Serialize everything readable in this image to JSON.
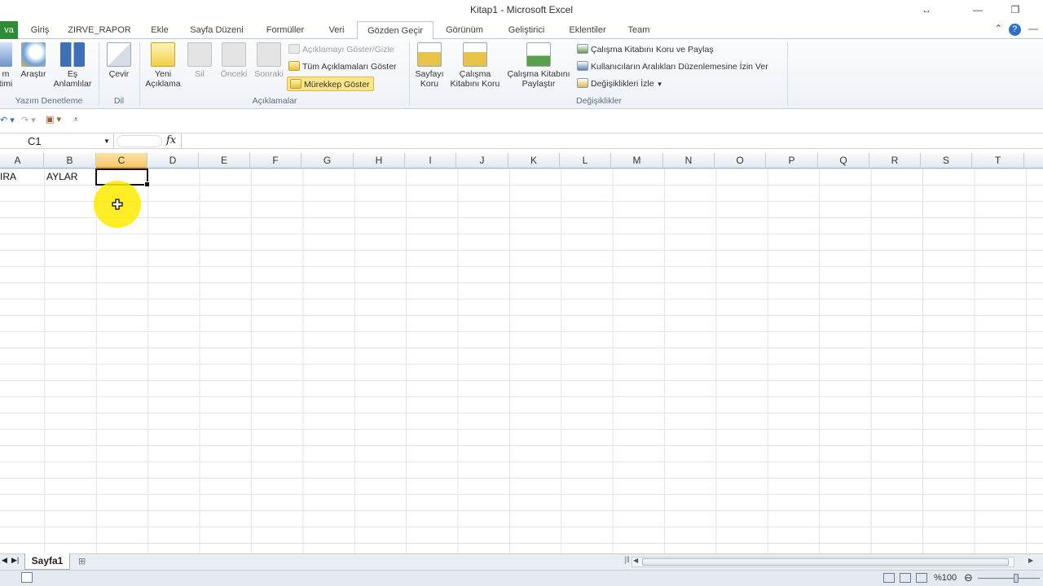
{
  "window": {
    "title": "Kitap1 - Microsoft Excel"
  },
  "tabs": {
    "file": "va",
    "items": [
      "Giriş",
      "ZIRVE_RAPOR",
      "Ekle",
      "Sayfa Düzeni",
      "Formüller",
      "Veri",
      "Gözden Geçir",
      "Görünüm",
      "Geliştirici",
      "Eklentiler",
      "Team"
    ],
    "active": "Gözden Geçir"
  },
  "ribbon": {
    "proofing": {
      "spell_label_line1": "m",
      "spell_label_line2": "timi",
      "research_label": "Araştır",
      "thesaurus_label_line1": "Eş",
      "thesaurus_label_line2": "Anlamlılar",
      "group_label": "Yazım Denetleme"
    },
    "language": {
      "translate_label": "Çevir",
      "group_label": "Dil"
    },
    "comments": {
      "new_comment_line1": "Yeni",
      "new_comment_line2": "Açıklama",
      "delete_label": "Sil",
      "previous_label": "Önceki",
      "next_label": "Sonraki",
      "show_hide_label": "Açıklamayı Göster/Gizle",
      "show_all_label": "Tüm Açıklamaları Göster",
      "show_ink_label": "Mürekkep Göster",
      "group_label": "Açıklamalar"
    },
    "changes": {
      "protect_sheet_line1": "Sayfayı",
      "protect_sheet_line2": "Koru",
      "protect_workbook_line1": "Çalışma",
      "protect_workbook_line2": "Kitabını Koru",
      "share_workbook_line1": "Çalışma Kitabını",
      "share_workbook_line2": "Paylaştır",
      "protect_share_label": "Çalışma Kitabını Koru ve Paylaş",
      "allow_edit_ranges_label": "Kullanıcıların Aralıkları Düzenlemesine İzin Ver",
      "track_changes_label": "Değişiklikleri İzle",
      "group_label": "Değişiklikler"
    }
  },
  "formula_bar": {
    "name_box": "C1",
    "fx_label": "fx",
    "formula": ""
  },
  "columns": [
    "A",
    "B",
    "C",
    "D",
    "E",
    "F",
    "G",
    "H",
    "I",
    "J",
    "K",
    "L",
    "M",
    "N",
    "O",
    "P",
    "Q",
    "R",
    "S",
    "T"
  ],
  "selected_column": "C",
  "cells": {
    "A1": "IRA",
    "B1": "AYLAR"
  },
  "sheets": {
    "active": "Sayfa1"
  },
  "status": {
    "zoom": "%100"
  },
  "colors": {
    "file_tab": "#2e8b37",
    "selection_header": "#f7c96c",
    "cursor_highlight": "#ffeb00"
  }
}
